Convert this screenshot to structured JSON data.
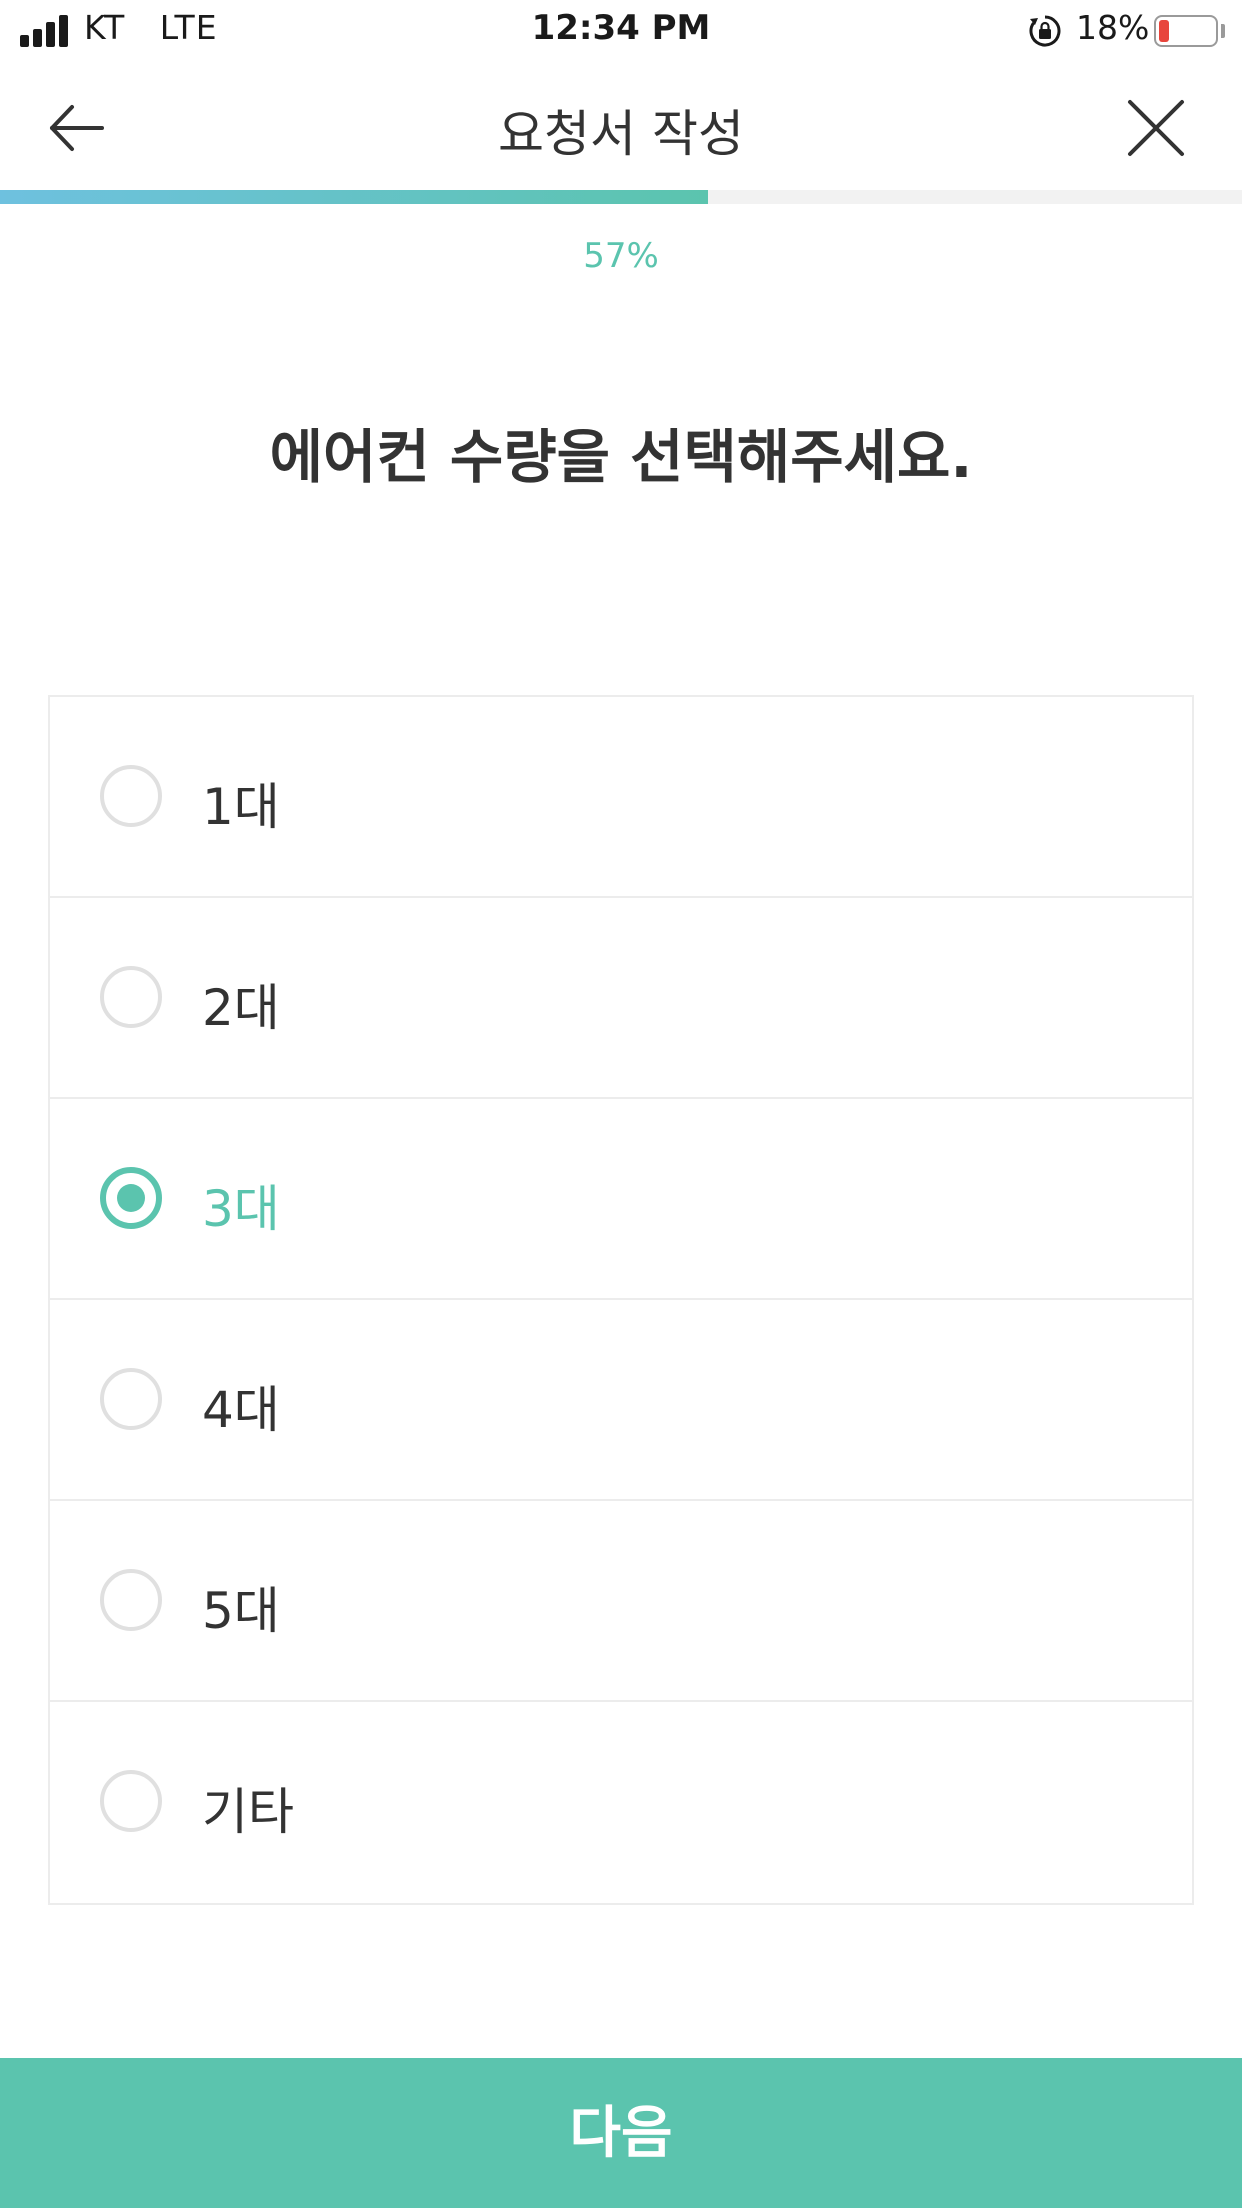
{
  "status_bar": {
    "carrier": "KT   LTE",
    "time": "12:34 PM",
    "battery_percent": "18%",
    "battery_level": 0.18,
    "signal_bars": 4,
    "icons": [
      "signal-icon",
      "rotation-lock-icon",
      "battery-icon"
    ]
  },
  "nav": {
    "title": "요청서 작성",
    "back_icon": "arrow-left-icon",
    "close_icon": "close-icon"
  },
  "progress": {
    "value": 0.57,
    "label": "57%"
  },
  "question": "에어컨 수량을 선택해주세요.",
  "options": [
    {
      "label": "1대",
      "selected": false
    },
    {
      "label": "2대",
      "selected": false
    },
    {
      "label": "3대",
      "selected": true
    },
    {
      "label": "4대",
      "selected": false
    },
    {
      "label": "5대",
      "selected": false
    },
    {
      "label": "기타",
      "selected": false
    }
  ],
  "next_button": {
    "label": "다음"
  },
  "colors": {
    "accent": "#5bc4ae",
    "progress_start": "#6ec1df",
    "text": "#333333",
    "border": "#ececec",
    "battery_low": "#e8453c"
  }
}
